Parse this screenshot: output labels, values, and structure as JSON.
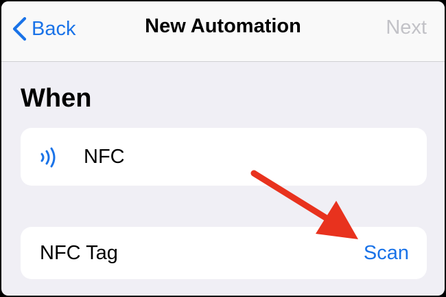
{
  "navbar": {
    "back_label": "Back",
    "title": "New Automation",
    "next_label": "Next"
  },
  "section": {
    "title": "When"
  },
  "trigger": {
    "icon": "nfc-waves-icon",
    "label": "NFC"
  },
  "tag_row": {
    "label": "NFC Tag",
    "action_label": "Scan"
  },
  "colors": {
    "accent": "#1a73e8",
    "disabled": "#c2c2c7",
    "annotation_arrow": "#e8321e",
    "background": "#f0eff5"
  }
}
